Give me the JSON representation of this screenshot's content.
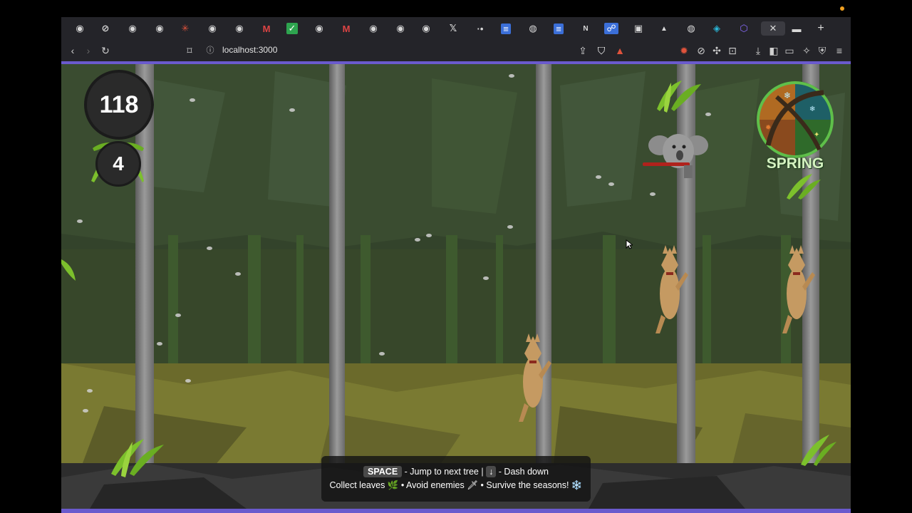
{
  "browser": {
    "url": "localhost:3000",
    "tabs": [
      {
        "icon": "github-icon"
      },
      {
        "icon": "generic-icon"
      },
      {
        "icon": "github-icon"
      },
      {
        "icon": "github-icon"
      },
      {
        "icon": "spark-icon"
      },
      {
        "icon": "github-icon"
      },
      {
        "icon": "github-icon"
      },
      {
        "icon": "gmail-icon"
      },
      {
        "icon": "check-icon"
      },
      {
        "icon": "github-icon"
      },
      {
        "icon": "gmail-icon"
      },
      {
        "icon": "github-icon"
      },
      {
        "icon": "github-icon"
      },
      {
        "icon": "github-icon"
      },
      {
        "icon": "x-icon"
      },
      {
        "icon": "dot-icon"
      },
      {
        "icon": "docs-icon"
      },
      {
        "icon": "globe-icon"
      },
      {
        "icon": "docs-icon"
      },
      {
        "icon": "notion-icon"
      },
      {
        "icon": "app-icon"
      },
      {
        "icon": "app-icon"
      },
      {
        "icon": "triangle-icon"
      },
      {
        "icon": "globe-icon"
      },
      {
        "icon": "diamond-icon"
      },
      {
        "icon": "hex-icon"
      },
      {
        "icon": "close-icon",
        "active": true
      },
      {
        "icon": "window-icon"
      }
    ],
    "new_tab": "+"
  },
  "game": {
    "score": "118",
    "lives": "4",
    "season": "SPRING",
    "help_line1_key1": "SPACE",
    "help_line1_text1": "- Jump to next tree |",
    "help_line1_key2": "↓",
    "help_line1_text2": "- Dash down",
    "help_line2": "Collect leaves 🌿 • Avoid enemies 🗡 • Survive the seasons! ❄️"
  },
  "colors": {
    "accent": "#6a5acd",
    "season_text": "#d4f2c0"
  }
}
